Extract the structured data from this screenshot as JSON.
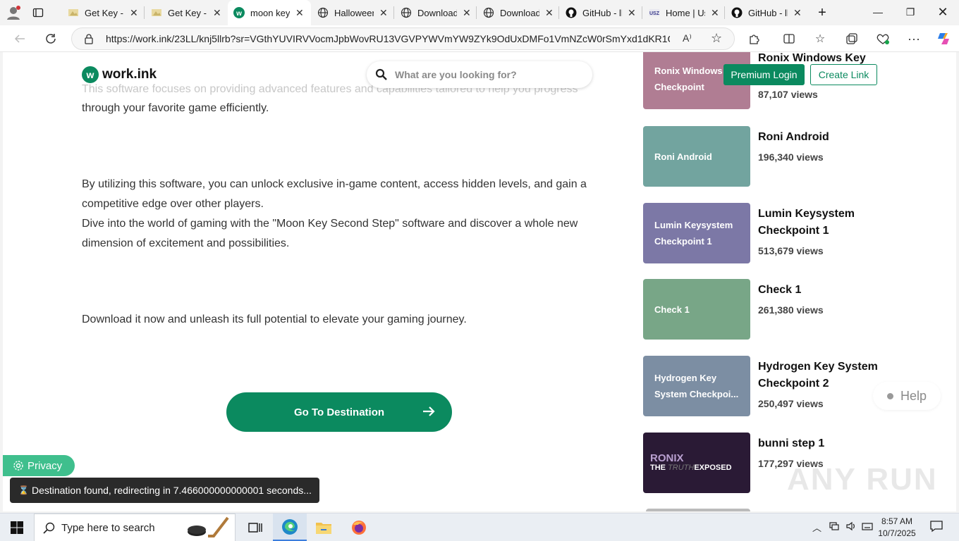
{
  "browser": {
    "tabs": [
      {
        "label": "Get Key - L",
        "favicon": "key-favicon"
      },
      {
        "label": "Get Key - L",
        "favicon": "key-favicon"
      },
      {
        "label": "moon key",
        "favicon": "workink-favicon",
        "active": true
      },
      {
        "label": "Halloween",
        "favicon": "globe-favicon"
      },
      {
        "label": "Download",
        "favicon": "globe-favicon"
      },
      {
        "label": "Download",
        "favicon": "globe-favicon"
      },
      {
        "label": "GitHub - ll",
        "favicon": "github-favicon"
      },
      {
        "label": "Home | Us",
        "favicon": "usz-favicon"
      },
      {
        "label": "GitHub - ll",
        "favicon": "github-favicon"
      }
    ],
    "url": "https://work.ink/23LL/knj5llrb?sr=VGthYUVIRVVocmJpbWovRU13VGVPYWVmYW9ZYk9OdUxDMFo1VmNZcW0rSmYxd1dKR1Qv..."
  },
  "header": {
    "logo_letter": "w",
    "logo_text": "work.ink",
    "search_placeholder": "What are you looking for?",
    "premium_label": "Premium Login",
    "create_label": "Create Link"
  },
  "article": {
    "faded_line": "This software focuses on providing advanced features and capabilities tailored to help you progress",
    "line_top": "through your favorite game efficiently.",
    "para2": "By utilizing this software, you can unlock exclusive in-game content, access hidden levels, and gain a competitive edge over other players.",
    "para3": "Dive into the world of gaming with the \"Moon Key Second Step\" software and discover a whole new dimension of excitement and possibilities.",
    "para4": "Download it now and unleash its full potential to elevate your gaming journey.",
    "button_label": "Go To Destination"
  },
  "sidebar": {
    "cards": [
      {
        "thumb_text": "Ronix Windows Checkpoint",
        "title": "Ronix Windows Key",
        "views": "87,107 views",
        "color": "#b07d93"
      },
      {
        "thumb_text": "Roni Android",
        "title": "Roni Android",
        "views": "196,340 views",
        "color": "#72a49f"
      },
      {
        "thumb_text": "Lumin Keysystem Checkpoint 1",
        "title": "Lumin Keysystem Checkpoint 1",
        "views": "513,679 views",
        "color": "#7c78a6"
      },
      {
        "thumb_text": "Check 1",
        "title": "Check 1",
        "views": "261,380 views",
        "color": "#78a687"
      },
      {
        "thumb_text": "Hydrogen Key System Checkpoi...",
        "title": "Hydrogen Key System Checkpoint 2",
        "views": "250,497 views",
        "color": "#7c8ea3"
      },
      {
        "thumb_text": "",
        "title": "bunni step 1",
        "views": "177,297 views",
        "color": "#2a1a35"
      }
    ],
    "bunni_thumb": {
      "brand": "RONIX",
      "tagline_a": "THE",
      "tagline_b": "TRUTH",
      "tagline_c": "EXPOSED"
    }
  },
  "overlays": {
    "privacy_label": "Privacy",
    "toast": "Destination found, redirecting in 7.466000000000001 seconds...",
    "help_label": "Help",
    "watermark": "ANY RUN"
  },
  "taskbar": {
    "search_placeholder": "Type here to search",
    "time": "8:57 AM",
    "date": "10/7/2025"
  },
  "colors": {
    "accent": "#0b8a5f",
    "privacy": "#3fbf8d"
  }
}
